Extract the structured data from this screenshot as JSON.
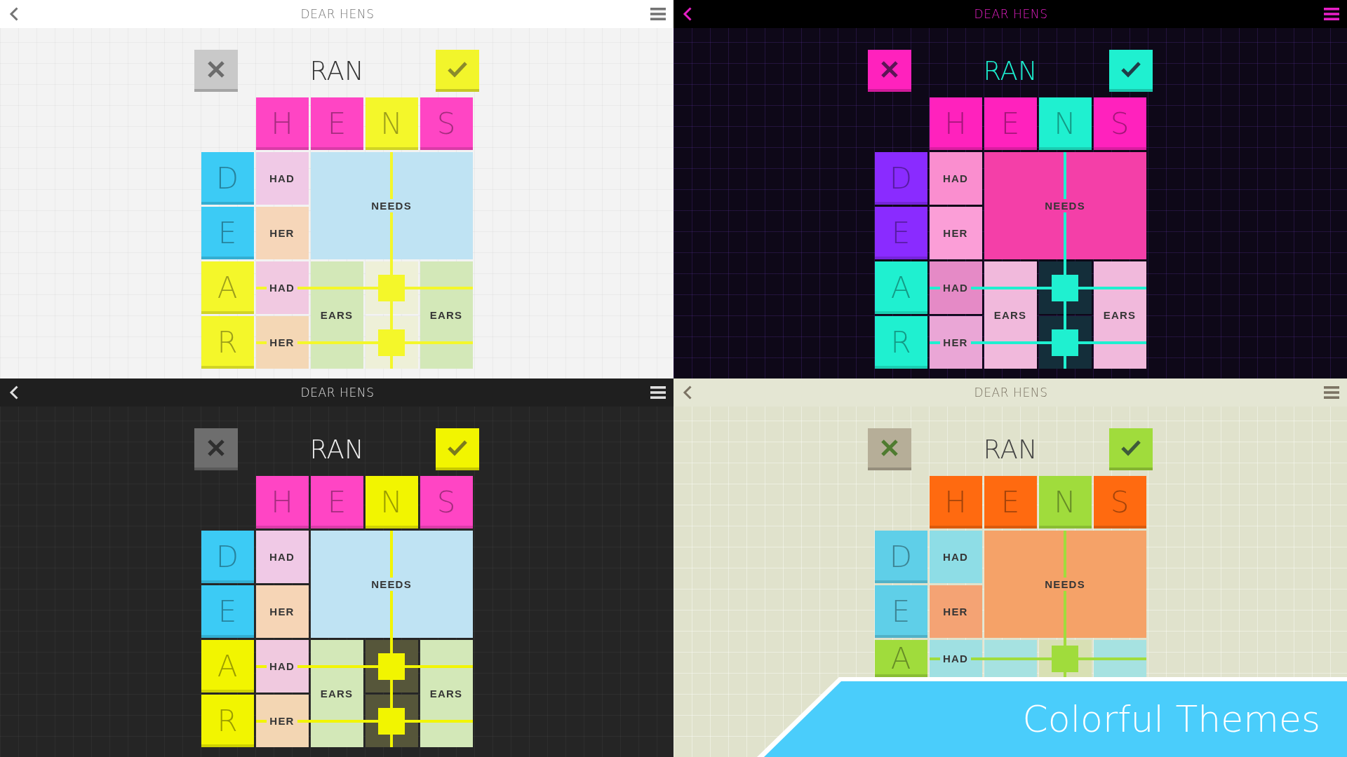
{
  "screens": [
    {
      "kind": "light",
      "title": "DEAR HENS",
      "word": "RAN",
      "columns": [
        {
          "letter": "H",
          "selected": false
        },
        {
          "letter": "E",
          "selected": false
        },
        {
          "letter": "N",
          "selected": true
        },
        {
          "letter": "S",
          "selected": false
        }
      ],
      "rows": [
        {
          "letter": "D",
          "selected": false,
          "cells": [
            {
              "text": "HAD",
              "color": "#f0c9e6"
            },
            {
              "text": "NEEDS",
              "colspan": 3,
              "rowspan": 2,
              "color": "#bfe3f3"
            }
          ]
        },
        {
          "letter": "E",
          "selected": false,
          "cells": [
            {
              "text": "HER",
              "color": "#f6d6b9"
            }
          ]
        },
        {
          "letter": "A",
          "selected": true,
          "cells": [
            {
              "text": "HAD",
              "color": "#f1c9e1"
            },
            {
              "text": "EARS",
              "rowspan": 2,
              "color": "#d3e8b8"
            },
            {
              "color": "#eef0d8"
            },
            {
              "text": "EARS",
              "rowspan": 2,
              "color": "#d3e8b8"
            }
          ]
        },
        {
          "letter": "R",
          "selected": true,
          "cells": [
            {
              "text": "HER",
              "color": "#f4d7b5"
            },
            {
              "color": "#eef0d8"
            }
          ]
        }
      ]
    },
    {
      "kind": "neon",
      "title": "DEAR HENS",
      "word": "RAN",
      "columns": [
        {
          "letter": "H",
          "selected": false
        },
        {
          "letter": "E",
          "selected": false
        },
        {
          "letter": "N",
          "selected": true
        },
        {
          "letter": "S",
          "selected": false
        }
      ],
      "rows": [
        {
          "letter": "D",
          "selected": false,
          "cells": [
            {
              "text": "HAD",
              "color": "#fa8ecf"
            },
            {
              "text": "NEEDS",
              "colspan": 3,
              "rowspan": 2,
              "color": "#f43fa8"
            }
          ]
        },
        {
          "letter": "E",
          "selected": false,
          "cells": [
            {
              "text": "HER",
              "color": "#fb9ed7"
            }
          ]
        },
        {
          "letter": "A",
          "selected": true,
          "cells": [
            {
              "text": "HAD",
              "color": "#e58ac6"
            },
            {
              "text": "EARS",
              "rowspan": 2,
              "color": "#f1b9dc"
            },
            {
              "color": "#142e3a"
            },
            {
              "text": "EARS",
              "rowspan": 2,
              "color": "#f1b9dc"
            }
          ]
        },
        {
          "letter": "R",
          "selected": true,
          "cells": [
            {
              "text": "HER",
              "color": "#eaa6d6"
            },
            {
              "color": "#142e3a"
            }
          ]
        }
      ]
    },
    {
      "kind": "dark",
      "title": "DEAR HENS",
      "word": "RAN",
      "columns": [
        {
          "letter": "H",
          "selected": false
        },
        {
          "letter": "E",
          "selected": false
        },
        {
          "letter": "N",
          "selected": true
        },
        {
          "letter": "S",
          "selected": false
        }
      ],
      "rows": [
        {
          "letter": "D",
          "selected": false,
          "cells": [
            {
              "text": "HAD",
              "color": "#f0c9e6"
            },
            {
              "text": "NEEDS",
              "colspan": 3,
              "rowspan": 2,
              "color": "#bfe3f3"
            }
          ]
        },
        {
          "letter": "E",
          "selected": false,
          "cells": [
            {
              "text": "HER",
              "color": "#f6d5b6"
            }
          ]
        },
        {
          "letter": "A",
          "selected": true,
          "cells": [
            {
              "text": "HAD",
              "color": "#f0c9df"
            },
            {
              "text": "EARS",
              "rowspan": 2,
              "color": "#d3e8b8"
            },
            {
              "color": "#56563a"
            },
            {
              "text": "EARS",
              "rowspan": 2,
              "color": "#d3e8b8"
            }
          ]
        },
        {
          "letter": "R",
          "selected": true,
          "cells": [
            {
              "text": "HER",
              "color": "#f3d6b3"
            },
            {
              "color": "#56563a"
            }
          ]
        }
      ]
    },
    {
      "kind": "sand",
      "title": "DEAR HENS",
      "word": "RAN",
      "columns": [
        {
          "letter": "H",
          "selected": false
        },
        {
          "letter": "E",
          "selected": false
        },
        {
          "letter": "N",
          "selected": true
        },
        {
          "letter": "S",
          "selected": false
        }
      ],
      "rows": [
        {
          "letter": "D",
          "selected": false,
          "cells": [
            {
              "text": "HAD",
              "color": "#8edde6"
            },
            {
              "text": "NEEDS",
              "colspan": 3,
              "rowspan": 2,
              "color": "#f5a268"
            }
          ]
        },
        {
          "letter": "E",
          "selected": false,
          "cells": [
            {
              "text": "HER",
              "color": "#f4a374"
            }
          ]
        },
        {
          "letter": "A",
          "selected": true,
          "cells": [
            {
              "text": "HAD",
              "color": "#9fe0e2"
            },
            {
              "color": "#a6e2e1"
            },
            {
              "color": "#d8e0b4"
            },
            {
              "color": "#a6e2e1"
            }
          ]
        }
      ],
      "banner": {
        "text": "Colorful Themes"
      }
    }
  ]
}
